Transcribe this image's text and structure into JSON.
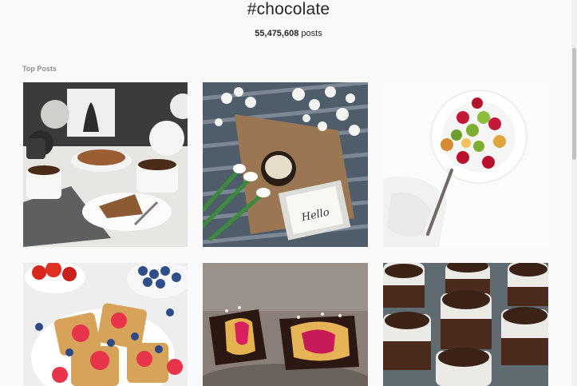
{
  "header": {
    "hashtag": "#chocolate",
    "post_count_number": "55,475,608",
    "post_count_suffix": " posts"
  },
  "top_posts": {
    "label": "Top Posts",
    "posts": [
      {
        "alt": "waffles and coffee on a tray"
      },
      {
        "alt": "hot chocolate with flowers and a Hello sign",
        "sign_text": "Hello"
      },
      {
        "alt": "fruit salad bowl"
      },
      {
        "alt": "waffles with strawberries and blueberries"
      },
      {
        "alt": "chocolate cups with raspberry filling"
      },
      {
        "alt": "chocolate mousse desserts in glasses"
      }
    ]
  },
  "colors": {
    "background": "#fafafa",
    "text": "#262626",
    "muted": "#8e8e8e"
  }
}
